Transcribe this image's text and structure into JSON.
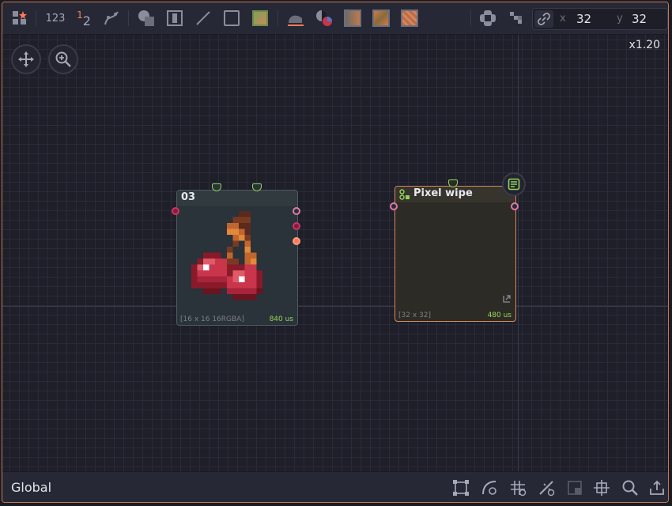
{
  "toolbar": {
    "numbers_label": "123",
    "superscript_one": "1",
    "subscript_two": "2",
    "link_x_label": "x",
    "link_x_value": "32",
    "link_y_label": "y",
    "link_y_value": "32"
  },
  "view": {
    "zoom_label": "x1.20"
  },
  "nodes": {
    "image_node": {
      "title": "03",
      "info": "[16 x 16 16RGBA]",
      "time": "840 us"
    },
    "pixel_wipe_node": {
      "title": "Pixel wipe",
      "info": "[32 x 32]",
      "time": "480 us"
    }
  },
  "statusbar": {
    "title": "Global"
  },
  "colors": {
    "accent_orange": "#d6895c",
    "time_green": "#9ad45a",
    "port_pink": "#e07aa8",
    "port_orange": "#ff7a5a",
    "port_green": "#8fd45a"
  }
}
